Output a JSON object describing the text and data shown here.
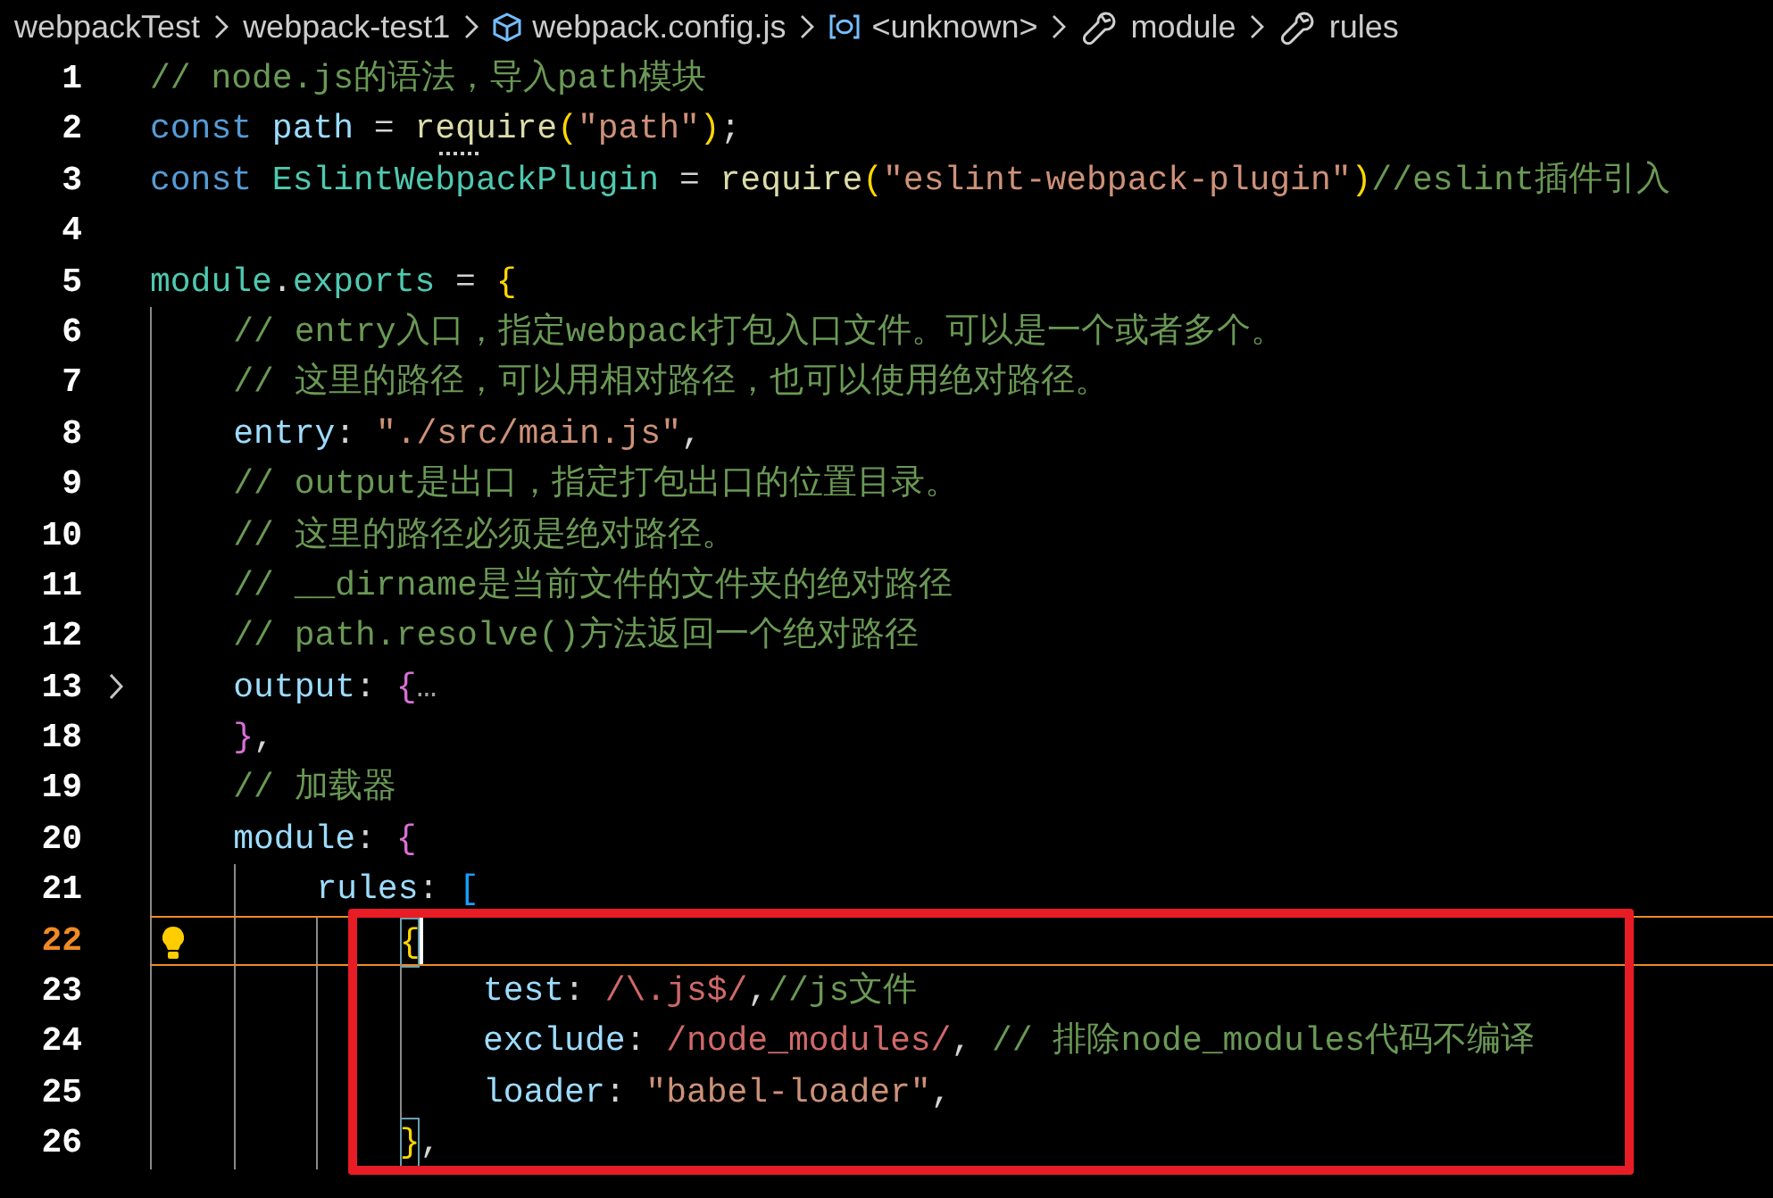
{
  "breadcrumbs": [
    {
      "label": "webpackTest",
      "kind": "folder"
    },
    {
      "label": "webpack-test1",
      "kind": "folder"
    },
    {
      "label": "webpack.config.js",
      "kind": "file"
    },
    {
      "label": "<unknown>",
      "kind": "symbol"
    },
    {
      "label": "module",
      "kind": "property"
    },
    {
      "label": "rules",
      "kind": "property"
    }
  ],
  "editor": {
    "lines": [
      {
        "number": "1",
        "folded": false,
        "current": false,
        "boxed": false,
        "tokens": [
          {
            "kind": "comment",
            "text": "// node.js的语法，导入path模块"
          }
        ]
      },
      {
        "number": "2",
        "folded": false,
        "current": false,
        "boxed": false,
        "tokens": [
          {
            "kind": "keyword",
            "text": "const "
          },
          {
            "kind": "variable",
            "text": "path"
          },
          {
            "kind": "punct",
            "text": " = "
          },
          {
            "kind": "function",
            "text": "require",
            "hint": true
          },
          {
            "kind": "bracket-gold",
            "text": "("
          },
          {
            "kind": "string",
            "text": "\"path\""
          },
          {
            "kind": "bracket-gold",
            "text": ")"
          },
          {
            "kind": "punct",
            "text": ";"
          }
        ]
      },
      {
        "number": "3",
        "folded": false,
        "current": false,
        "boxed": false,
        "tokens": [
          {
            "kind": "keyword",
            "text": "const "
          },
          {
            "kind": "class",
            "text": "EslintWebpackPlugin"
          },
          {
            "kind": "punct",
            "text": " = "
          },
          {
            "kind": "function",
            "text": "require",
            "hint": false
          },
          {
            "kind": "bracket-gold",
            "text": "("
          },
          {
            "kind": "string",
            "text": "\"eslint-webpack-plugin\""
          },
          {
            "kind": "bracket-gold",
            "text": ")"
          },
          {
            "kind": "comment",
            "text": "//eslint插件引入"
          }
        ]
      },
      {
        "number": "4",
        "folded": false,
        "current": false,
        "boxed": false
      },
      {
        "number": "5",
        "folded": false,
        "current": false,
        "boxed": false,
        "tokens": [
          {
            "kind": "class",
            "text": "module"
          },
          {
            "kind": "punct",
            "text": "."
          },
          {
            "kind": "class",
            "text": "exports"
          },
          {
            "kind": "punct",
            "text": " = "
          },
          {
            "kind": "bracket-gold",
            "text": "{"
          }
        ]
      },
      {
        "number": "6",
        "folded": false,
        "current": false,
        "boxed": false,
        "tokens": [
          {
            "kind": "comment",
            "text": "    // entry入口，指定webpack打包入口文件。可以是一个或者多个。"
          }
        ]
      },
      {
        "number": "7",
        "folded": false,
        "current": false,
        "boxed": false,
        "tokens": [
          {
            "kind": "comment",
            "text": "    // 这里的路径，可以用相对路径，也可以使用绝对路径。"
          }
        ]
      },
      {
        "number": "8",
        "folded": false,
        "current": false,
        "boxed": false,
        "tokens": [
          {
            "kind": "property",
            "text": "    entry"
          },
          {
            "kind": "punct",
            "text": ": "
          },
          {
            "kind": "string",
            "text": "\"./src/main.js\""
          },
          {
            "kind": "punct",
            "text": ","
          }
        ]
      },
      {
        "number": "9",
        "folded": false,
        "current": false,
        "boxed": false,
        "tokens": [
          {
            "kind": "comment",
            "text": "    // output是出口，指定打包出口的位置目录。"
          }
        ]
      },
      {
        "number": "10",
        "folded": false,
        "current": false,
        "boxed": false,
        "tokens": [
          {
            "kind": "comment",
            "text": "    // 这里的路径必须是绝对路径。"
          }
        ]
      },
      {
        "number": "11",
        "folded": false,
        "current": false,
        "boxed": false,
        "tokens": [
          {
            "kind": "comment",
            "text": "    // __dirname是当前文件的文件夹的绝对路径"
          }
        ]
      },
      {
        "number": "12",
        "folded": false,
        "current": false,
        "boxed": false,
        "tokens": [
          {
            "kind": "comment",
            "text": "    // path.resolve()方法返回一个绝对路径"
          }
        ]
      },
      {
        "number": "13",
        "folded": true,
        "current": false,
        "boxed": false,
        "tokens": [
          {
            "kind": "property",
            "text": "    output"
          },
          {
            "kind": "punct",
            "text": ": "
          },
          {
            "kind": "bracket-orchid",
            "text": "{"
          },
          {
            "kind": "ellipsis",
            "text": "…"
          }
        ]
      },
      {
        "number": "18",
        "folded": false,
        "current": false,
        "boxed": false,
        "tokens": [
          {
            "kind": "bracket-orchid",
            "text": "    }"
          },
          {
            "kind": "punct",
            "text": ","
          }
        ]
      },
      {
        "number": "19",
        "folded": false,
        "current": false,
        "boxed": false,
        "tokens": [
          {
            "kind": "comment",
            "text": "    // 加载器"
          }
        ]
      },
      {
        "number": "20",
        "folded": false,
        "current": false,
        "boxed": false,
        "tokens": [
          {
            "kind": "property",
            "text": "    module"
          },
          {
            "kind": "punct",
            "text": ": "
          },
          {
            "kind": "bracket-orchid",
            "text": "{"
          }
        ]
      },
      {
        "number": "21",
        "folded": false,
        "current": false,
        "boxed": false,
        "tokens": [
          {
            "kind": "property",
            "text": "        rules"
          },
          {
            "kind": "punct",
            "text": ": "
          },
          {
            "kind": "bracket-blue",
            "text": "["
          }
        ]
      },
      {
        "number": "22",
        "folded": false,
        "current": true,
        "boxed": true,
        "tokens": [
          {
            "kind": "bracket-gold",
            "text": "            {",
            "matched": true,
            "caret": true
          }
        ]
      },
      {
        "number": "23",
        "folded": false,
        "current": false,
        "boxed": true,
        "tokens": [
          {
            "kind": "property",
            "text": "                test"
          },
          {
            "kind": "punct",
            "text": ": "
          },
          {
            "kind": "regex",
            "text": "/\\.js$/"
          },
          {
            "kind": "punct",
            "text": ","
          },
          {
            "kind": "comment",
            "text": "//js文件"
          }
        ]
      },
      {
        "number": "24",
        "folded": false,
        "current": false,
        "boxed": true,
        "tokens": [
          {
            "kind": "property",
            "text": "                exclude"
          },
          {
            "kind": "punct",
            "text": ": "
          },
          {
            "kind": "regex",
            "text": "/node_modules/"
          },
          {
            "kind": "punct",
            "text": ", "
          },
          {
            "kind": "comment",
            "text": "// 排除node_modules代码不编译"
          }
        ]
      },
      {
        "number": "25",
        "folded": false,
        "current": false,
        "boxed": true,
        "tokens": [
          {
            "kind": "property",
            "text": "                loader"
          },
          {
            "kind": "punct",
            "text": ": "
          },
          {
            "kind": "string",
            "text": "\"babel-loader\""
          },
          {
            "kind": "punct",
            "text": ","
          }
        ]
      },
      {
        "number": "26",
        "folded": false,
        "current": false,
        "boxed": true,
        "tokens": [
          {
            "kind": "bracket-gold",
            "text": "            }",
            "matched": true,
            "caret": false
          },
          {
            "kind": "punct",
            "text": ","
          }
        ]
      }
    ]
  }
}
